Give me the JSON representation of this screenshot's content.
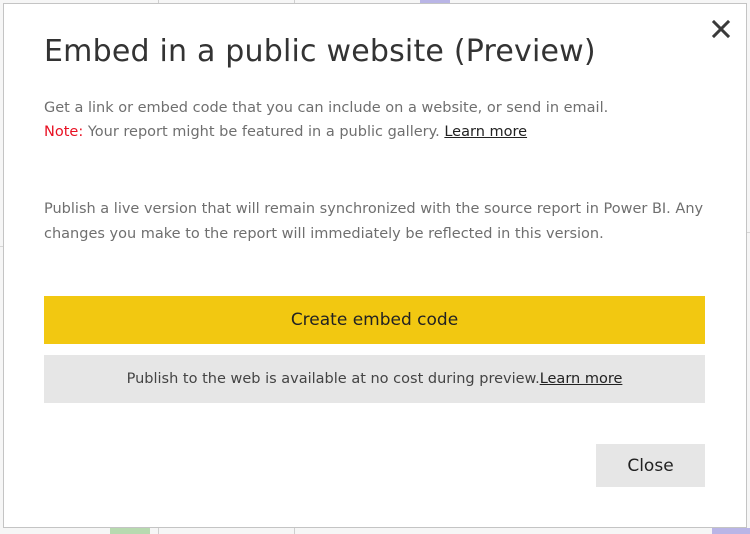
{
  "dialog": {
    "title": "Embed in a public website (Preview)",
    "close_icon": "close-icon",
    "intro_text": "Get a link or embed code that you can include on a website, or send in email.",
    "note_label": "Note:",
    "note_text": " Your report might be featured in a public gallery. ",
    "note_link": "Learn more",
    "description": "Publish a live version that will remain synchronized with the source report in Power BI. Any changes you make to the report will immediately be reflected in this version.",
    "create_button_label": "Create embed code",
    "info_text": "Publish to the web is available at no cost during preview. ",
    "info_link": "Learn more",
    "close_button_label": "Close"
  },
  "colors": {
    "accent_yellow": "#f2c811",
    "note_red": "#e81123",
    "info_background": "#e6e6e6",
    "body_text": "#6f6f6f",
    "title_text": "#333333"
  }
}
